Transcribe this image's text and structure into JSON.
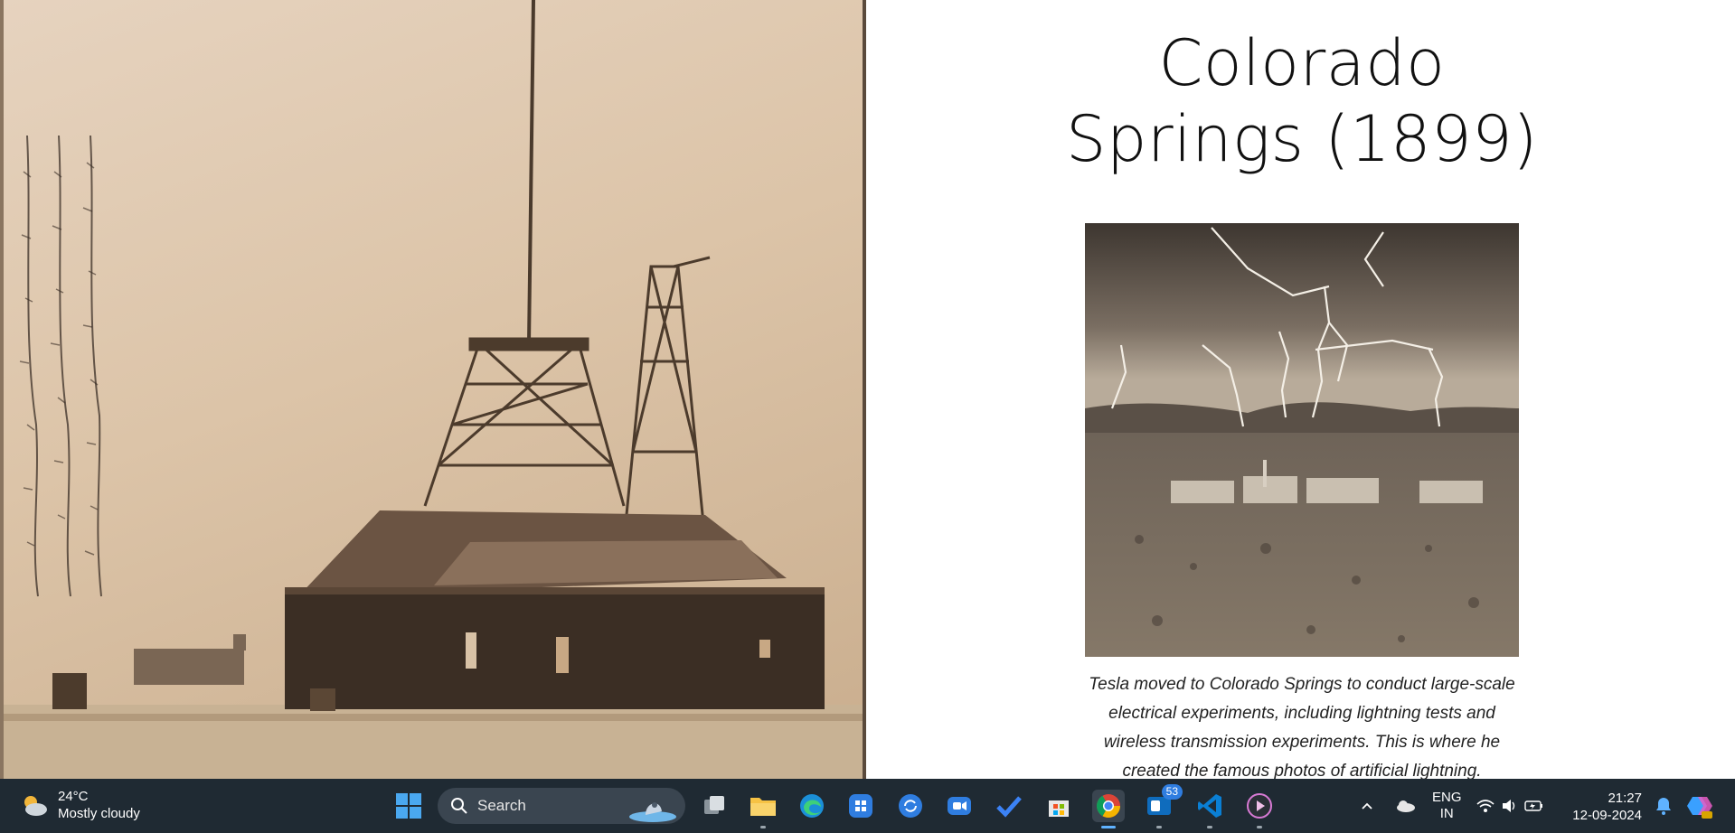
{
  "page": {
    "title_line1": "Colorado",
    "title_line2": "Springs (1899)",
    "caption": "Tesla moved to Colorado Springs to conduct large-scale electrical experiments, including lightning tests and wireless transmission experiments. This is where he created the famous photos of artificial lightning."
  },
  "taskbar": {
    "weather_temp": "24°C",
    "weather_desc": "Mostly cloudy",
    "search_label": "Search",
    "outlook_badge": "53",
    "lang_line1": "ENG",
    "lang_line2": "IN",
    "time": "21:27",
    "date": "12-09-2024",
    "colors": {
      "bg": "#1f2a33",
      "accent": "#5fb2ff"
    }
  }
}
